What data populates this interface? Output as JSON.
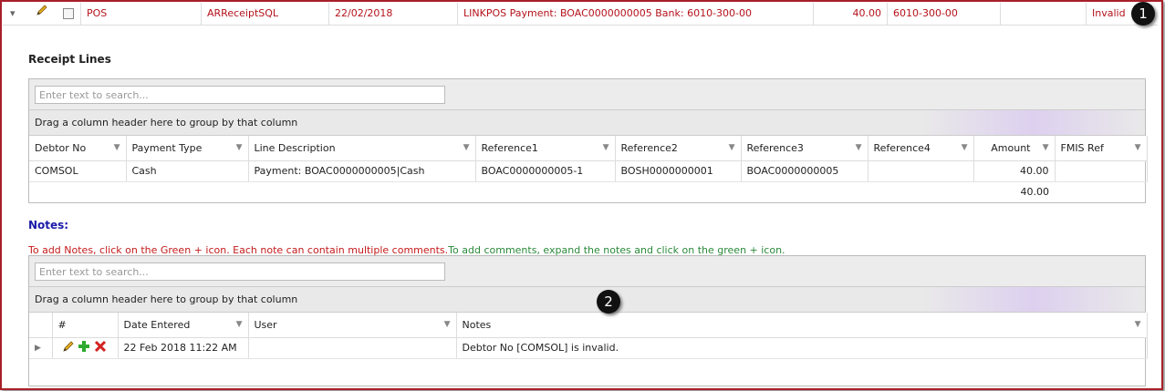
{
  "top_row": {
    "source": "POS",
    "type": "ARReceiptSQL",
    "date": "22/02/2018",
    "description": "LINKPOS Payment: BOAC0000000005 Bank: 6010-300-00",
    "amount": "40.00",
    "account": "6010-300-00",
    "status": "Invalid",
    "badge": "1"
  },
  "receipt_lines": {
    "title": "Receipt Lines",
    "search_placeholder": "Enter text to search...",
    "group_hint": "Drag a column header here to group by that column",
    "columns": [
      "Debtor No",
      "Payment Type",
      "Line Description",
      "Reference1",
      "Reference2",
      "Reference3",
      "Reference4",
      "Amount",
      "FMIS Ref"
    ],
    "rows": [
      [
        "COMSOL",
        "Cash",
        "Payment: BOAC0000000005|Cash",
        "BOAC0000000005-1",
        "BOSH0000000001",
        "BOAC0000000005",
        "",
        "40.00",
        ""
      ]
    ],
    "total": "40.00"
  },
  "notes": {
    "title": "Notes:",
    "help_red": "To add Notes, click on the Green + icon. Each note can contain multiple comments.",
    "help_green": "To add comments, expand the notes and click on the green + icon.",
    "search_placeholder": "Enter text to search...",
    "group_hint": "Drag a column header here to group by that column",
    "badge": "2",
    "columns": [
      "#",
      "Date Entered",
      "User",
      "Notes"
    ],
    "rows": [
      {
        "date": "22 Feb 2018 11:22 AM",
        "user": "",
        "note": "Debtor No [COMSOL] is invalid."
      }
    ]
  }
}
